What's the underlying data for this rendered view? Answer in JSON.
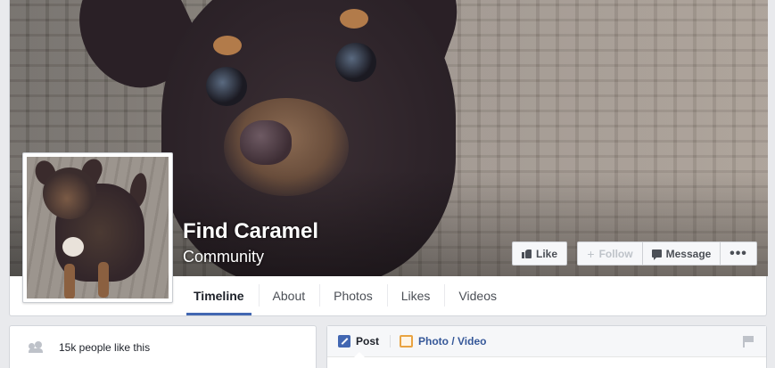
{
  "page": {
    "title": "Find Caramel",
    "category": "Community"
  },
  "actions": {
    "like_label": "Like",
    "follow_label": "Follow",
    "message_label": "Message",
    "more_label": "•••"
  },
  "tabs": [
    {
      "label": "Timeline",
      "active": true
    },
    {
      "label": "About"
    },
    {
      "label": "Photos"
    },
    {
      "label": "Likes"
    },
    {
      "label": "Videos"
    }
  ],
  "sidebar": {
    "likes_text": "15k people like this"
  },
  "composer": {
    "post_label": "Post",
    "photo_label": "Photo / Video"
  },
  "colors": {
    "accent": "#4267b2",
    "background": "#e9eaed"
  },
  "icons": [
    "thumbs-up-icon",
    "plus-icon",
    "message-icon",
    "more-icon",
    "people-icon",
    "pencil-icon",
    "photo-icon",
    "flag-icon"
  ]
}
